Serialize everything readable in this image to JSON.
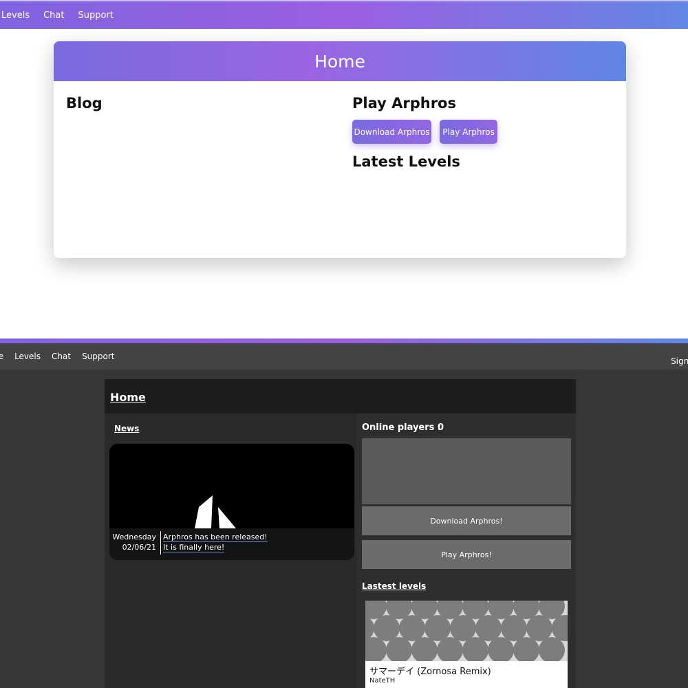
{
  "light": {
    "nav": {
      "items": [
        {
          "label": "Levels"
        },
        {
          "label": "Chat"
        },
        {
          "label": "Support"
        }
      ]
    },
    "card": {
      "title": "Home",
      "blog_heading": "Blog",
      "play_heading": "Play Arphros",
      "download_button": "Download Arphros",
      "play_button": "Play Arphros",
      "latest_heading": "Latest Levels"
    }
  },
  "dark": {
    "nav": {
      "items": [
        {
          "label": "me"
        },
        {
          "label": "Levels"
        },
        {
          "label": "Chat"
        },
        {
          "label": "Support"
        }
      ],
      "sign_in": "Sign in"
    },
    "panel": {
      "title": "Home",
      "news_label": "News",
      "news_item": {
        "day": "Wednesday",
        "date": "02/06/21",
        "headline": "Arphros has been released!",
        "subline": "It is finally here!"
      },
      "online_label": "Online players :",
      "online_count": "0",
      "download_button": "Download Arphros!",
      "play_button": "Play Arphros!",
      "latest_label": "Lastest levels",
      "level": {
        "name": "サマーデイ (Zornosa Remix)",
        "author": "NateTH"
      }
    }
  },
  "colors": {
    "accent_start": "#7a6be0",
    "accent_mid": "#9b5fe3",
    "accent_end": "#6287e6",
    "dark_bg": "#363636",
    "dark_panel": "#2a2a2a",
    "dark_button": "#6b6b6b"
  }
}
